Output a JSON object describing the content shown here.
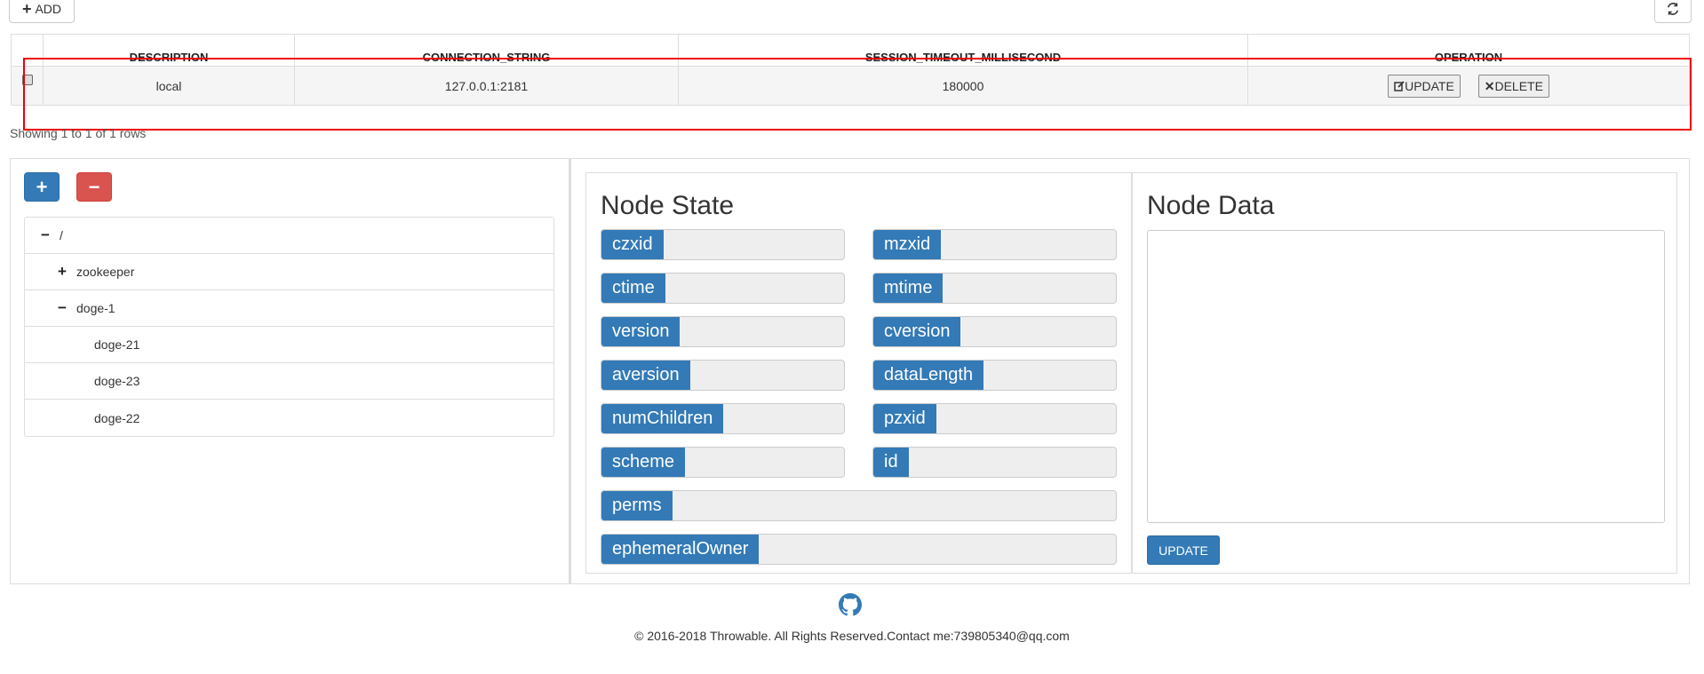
{
  "toolbar": {
    "add_label": "ADD"
  },
  "table": {
    "columns": [
      "DESCRIPTION",
      "CONNECTION_STRING",
      "SESSION_TIMEOUT_MILLISECOND",
      "OPERATION"
    ],
    "rows": [
      {
        "description": "local",
        "connection_string": "127.0.0.1:2181",
        "session_timeout": "180000",
        "update_label": "UPDATE",
        "delete_label": "DELETE"
      }
    ],
    "showing": "Showing 1 to 1 of 1 rows"
  },
  "tree": {
    "add_label": "+",
    "remove_label": "−",
    "nodes": [
      {
        "label": "/",
        "toggle": "−"
      },
      {
        "label": "zookeeper",
        "toggle": "+"
      },
      {
        "label": "doge-1",
        "toggle": "−"
      },
      {
        "label": "doge-21",
        "toggle": ""
      },
      {
        "label": "doge-23",
        "toggle": ""
      },
      {
        "label": "doge-22",
        "toggle": ""
      }
    ]
  },
  "node_state": {
    "title": "Node State",
    "fields": [
      "czxid",
      "mzxid",
      "ctime",
      "mtime",
      "version",
      "cversion",
      "aversion",
      "dataLength",
      "numChildren",
      "pzxid",
      "scheme",
      "id",
      "perms",
      "ephemeralOwner"
    ]
  },
  "node_data": {
    "title": "Node Data",
    "update_label": "UPDATE"
  },
  "footer": {
    "text": "© 2016-2018 Throwable. All Rights Reserved.Contact me:739805340@qq.com"
  },
  "colors": {
    "primary": "#337ab7",
    "danger": "#d9534f",
    "highlight": "#e00000"
  },
  "icons": {
    "refresh": "refresh-icon",
    "github": "github-icon"
  }
}
